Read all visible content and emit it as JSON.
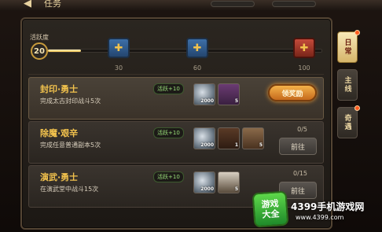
{
  "header": {
    "title": "任务",
    "back_icon": "back-arrow-icon"
  },
  "activity": {
    "label": "活跃度",
    "current": "20",
    "progress_value": 20,
    "progress_max": 100,
    "milestones": [
      {
        "value": "30",
        "chest": "blue-chest-icon"
      },
      {
        "value": "60",
        "chest": "blue-chest-icon"
      },
      {
        "value": "100",
        "chest": "red-chest-icon"
      }
    ]
  },
  "tasks": [
    {
      "title": "封印·勇士",
      "desc": "完成太古封印战斗5次",
      "tag": "活跃+10",
      "rewards": [
        {
          "icon": "silver-coin-icon",
          "qty": "2000"
        },
        {
          "icon": "hero-portrait-icon",
          "qty": "5"
        }
      ],
      "action": "领奖励",
      "progress": ""
    },
    {
      "title": "除魔·艰辛",
      "desc": "完成任意普通副本5次",
      "tag": "活跃+10",
      "rewards": [
        {
          "icon": "silver-coin-icon",
          "qty": "2000"
        },
        {
          "icon": "book-icon",
          "qty": "1"
        },
        {
          "icon": "hero-portrait-icon",
          "qty": "5"
        }
      ],
      "action": "前往",
      "progress": "0/5"
    },
    {
      "title": "演武·勇士",
      "desc": "在演武堂中战斗15次",
      "tag": "活跃+10",
      "rewards": [
        {
          "icon": "silver-coin-icon",
          "qty": "2000"
        },
        {
          "icon": "panda-portrait-icon",
          "qty": "5"
        }
      ],
      "action": "前往",
      "progress": "0/15"
    }
  ],
  "tabs": [
    {
      "label": "日常",
      "active": true,
      "dot": true
    },
    {
      "label": "主线",
      "active": false,
      "dot": false
    },
    {
      "label": "奇遇",
      "active": false,
      "dot": true
    }
  ],
  "watermark": {
    "badge_line1": "游戏",
    "badge_line2": "大全",
    "site": "4399手机游戏网",
    "url": "www.4399.com"
  },
  "colors": {
    "accent": "#f2c24d",
    "claim": "#e79634",
    "tag": "#9ae07a"
  }
}
